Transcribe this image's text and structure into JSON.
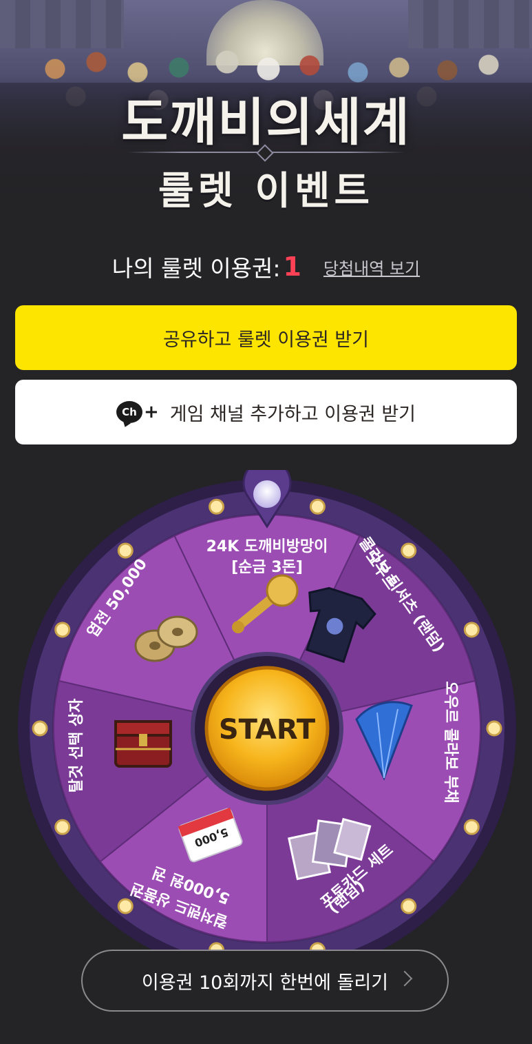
{
  "header": {
    "title": "도깨비의세계",
    "subtitle": "룰렛 이벤트"
  },
  "ticket": {
    "label": "나의 룰렛 이용권:",
    "count": "1",
    "history_link": "당첨내역 보기"
  },
  "buttons": {
    "share": "공유하고 룰렛 이용권 받기",
    "channel_icon_text": "Ch",
    "channel_icon_plus": "+",
    "channel": "게임 채널 추가하고 이용권 받기",
    "multi_spin": "이용권 10회까지 한번에 돌리기"
  },
  "roulette": {
    "start_label": "START",
    "segments": [
      {
        "label_line1": "24K 도깨비방망이",
        "label_line2": "[순금 3돈]",
        "icon": "golden-club-icon"
      },
      {
        "label_line1": "오우르",
        "label_line2": "콜라보 티셔츠 (랜덤)",
        "icon": "tshirt-icon"
      },
      {
        "label_line1": "오우르 콜라보 부채",
        "label_line2": "",
        "icon": "fan-icon"
      },
      {
        "label_line1": "포토카드 세트",
        "label_line2": "(랜덤)",
        "icon": "photocard-icon"
      },
      {
        "label_line1": "컬처랜드 상품권",
        "label_line2": "5,000원 권",
        "icon": "gift-card-icon"
      },
      {
        "label_line1": "탈것 선택 상자",
        "label_line2": "",
        "icon": "treasure-chest-icon"
      },
      {
        "label_line1": "엽전 50,000",
        "label_line2": "",
        "icon": "coins-icon"
      }
    ],
    "gift_card_value": "5,000",
    "colors": {
      "segment_a": "#7a3a96",
      "segment_b": "#9b4db3",
      "rim": "#3b2a5e",
      "start": "#f7b51c"
    }
  }
}
